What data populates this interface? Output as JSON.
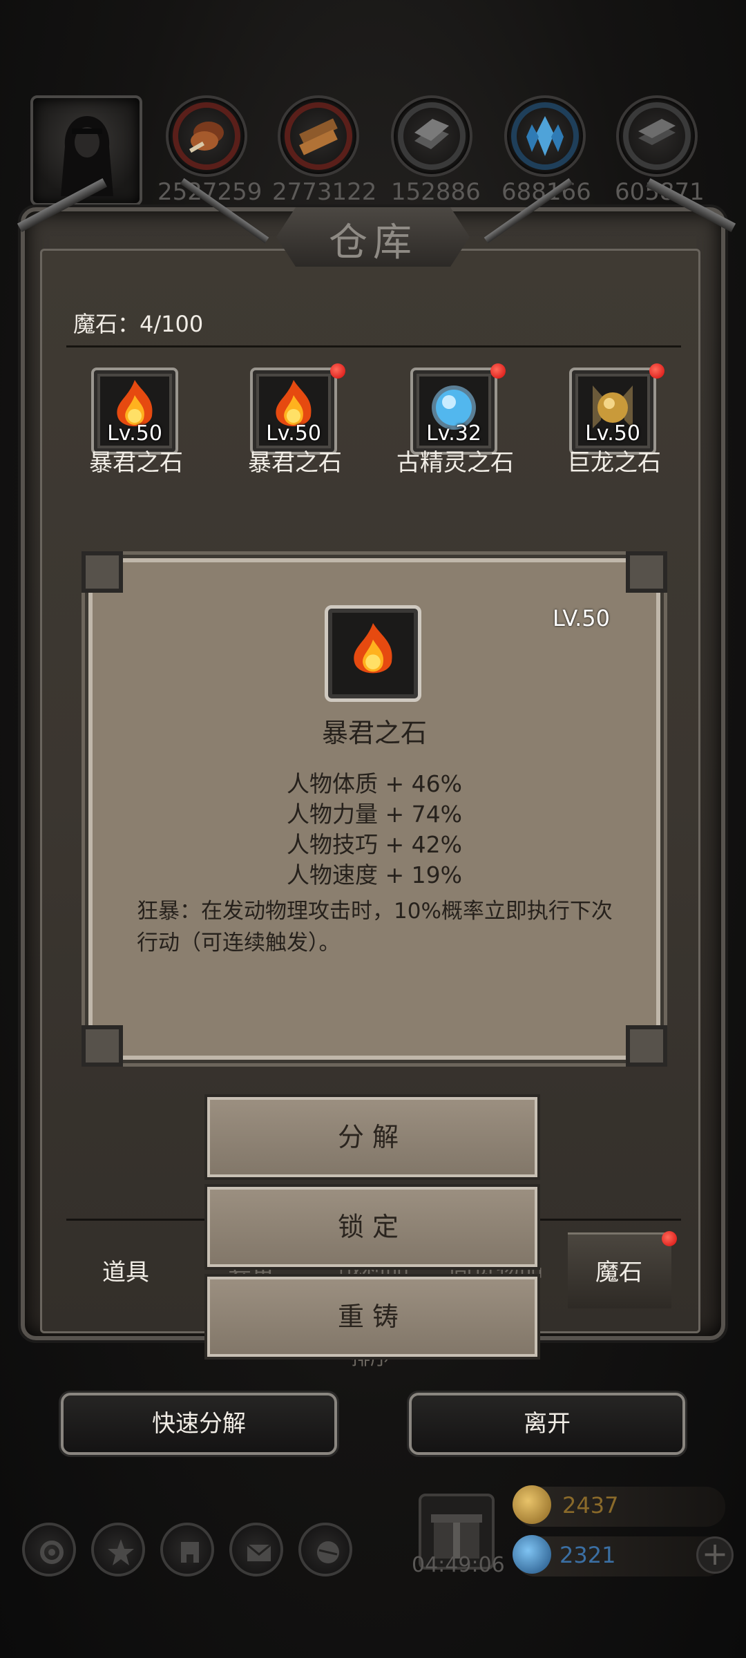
{
  "top_bar": {
    "resources": [
      {
        "icon": "meat-icon",
        "count": "2527259"
      },
      {
        "icon": "wood-icon",
        "count": "2773122"
      },
      {
        "icon": "stone-icon",
        "count": "152886"
      },
      {
        "icon": "crystal-icon",
        "count": "688166"
      },
      {
        "icon": "iron-icon",
        "count": "605871"
      }
    ]
  },
  "panel": {
    "title": "仓库",
    "stone_count": "魔石：4/100"
  },
  "items": [
    {
      "level": "Lv.50",
      "name": "暴君之石",
      "icon": "fire-stone-icon",
      "has_badge": false
    },
    {
      "level": "Lv.50",
      "name": "暴君之石",
      "icon": "fire-stone-icon",
      "has_badge": true
    },
    {
      "level": "Lv.32",
      "name": "古精灵之石",
      "icon": "elf-stone-icon",
      "has_badge": true
    },
    {
      "level": "Lv.50",
      "name": "巨龙之石",
      "icon": "dragon-stone-icon",
      "has_badge": true
    }
  ],
  "detail": {
    "level": "LV.50",
    "name": "暴君之石",
    "stats": [
      "人物体质 + 46%",
      "人物力量 + 74%",
      "人物技巧 + 42%",
      "人物速度 + 19%"
    ],
    "description": "狂暴：在发动物理攻击时，10%概率立即执行下次行动（可连续触发）。"
  },
  "actions": {
    "decompose": "分解",
    "lock": "锁定",
    "reforge": "重铸"
  },
  "tabs": {
    "props": "道具",
    "hidden_1": "套备",
    "hidden_2": "战利品",
    "hidden_3": "高贵物品",
    "stones": "魔石",
    "sort": "排序"
  },
  "bottom_buttons": {
    "quick_decompose": "快速分解",
    "leave": "离开"
  },
  "footer": {
    "timer": "04:49:06",
    "gold": "2437",
    "gems": "2321",
    "gold_color": "#b8862a",
    "gem_color": "#3b7bbd"
  }
}
